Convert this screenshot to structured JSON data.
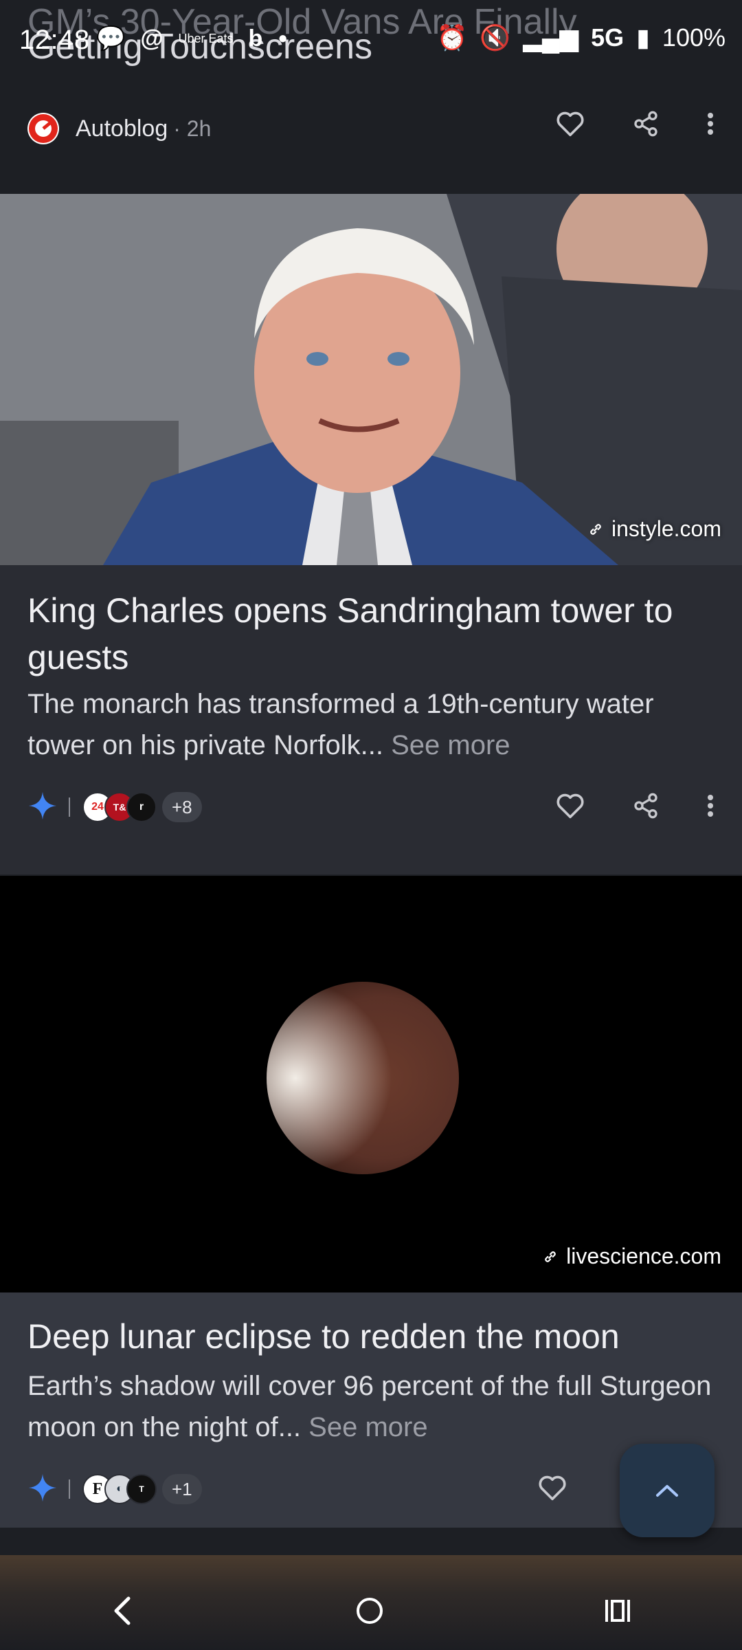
{
  "status_bar": {
    "time": "12:48",
    "network": "5G",
    "battery": "100%",
    "uber_label": "Uber Eats"
  },
  "previous_card": {
    "title_faded": "GM’s 30-Year-Old Vans Are Finally",
    "title": "Getting Touchscreens",
    "source": "Autoblog",
    "time": "· 2h"
  },
  "card1": {
    "image_domain": "instyle.com",
    "title": "King Charles opens Sandringham tower to guests",
    "description": "The monarch has transformed a 19th-century water tower on his private Norfolk...",
    "see_more": "See more",
    "extra_sources": "+8"
  },
  "card2": {
    "image_domain": "livescience.com",
    "title": "Deep lunar eclipse to redden the moon",
    "description": "Earth’s shadow will cover 96 percent of the full Sturgeon moon on the night of...",
    "see_more": "See more",
    "extra_sources": "+1"
  },
  "colors": {
    "background": "#1d1f24",
    "card_body": "#2a2c33",
    "fab": "#233549",
    "gemini_blue": "#4285f4"
  },
  "icons": [
    "heart-icon",
    "share-icon",
    "more-vert-icon",
    "link-icon",
    "sparkle-icon",
    "chevron-up-icon",
    "back-icon",
    "home-icon",
    "recents-icon"
  ]
}
